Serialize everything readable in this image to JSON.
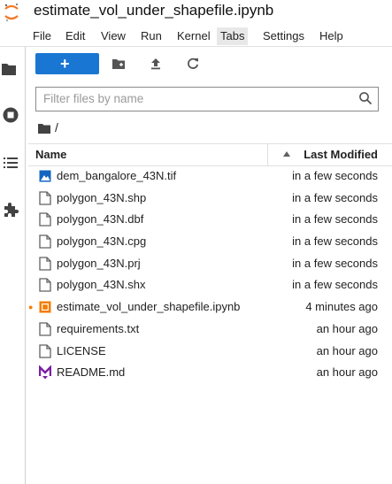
{
  "window": {
    "title": "estimate_vol_under_shapefile.ipynb"
  },
  "menu": [
    {
      "label": "File"
    },
    {
      "label": "Edit"
    },
    {
      "label": "View"
    },
    {
      "label": "Run"
    },
    {
      "label": "Kernel"
    },
    {
      "label": "Tabs"
    },
    {
      "label": "Settings"
    },
    {
      "label": "Help"
    }
  ],
  "sidebar": [
    "folder-icon",
    "running-icon",
    "toc-icon",
    "extension-icon"
  ],
  "toolbar": {
    "new_label": "+",
    "icons": [
      "new-folder-icon",
      "upload-icon",
      "refresh-icon"
    ]
  },
  "filter": {
    "placeholder": "Filter files by name",
    "value": ""
  },
  "breadcrumb": {
    "path": "/"
  },
  "table": {
    "col_name": "Name",
    "col_modified": "Last Modified",
    "rows": [
      {
        "name": "dem_bangalore_43N.tif",
        "modified": "in a few seconds",
        "icon": "image-file-icon"
      },
      {
        "name": "polygon_43N.shp",
        "modified": "in a few seconds",
        "icon": "file-icon"
      },
      {
        "name": "polygon_43N.dbf",
        "modified": "in a few seconds",
        "icon": "file-icon"
      },
      {
        "name": "polygon_43N.cpg",
        "modified": "in a few seconds",
        "icon": "file-icon"
      },
      {
        "name": "polygon_43N.prj",
        "modified": "in a few seconds",
        "icon": "file-icon"
      },
      {
        "name": "polygon_43N.shx",
        "modified": "in a few seconds",
        "icon": "file-icon"
      },
      {
        "name": "estimate_vol_under_shapefile.ipynb",
        "modified": "4 minutes ago",
        "icon": "notebook-icon",
        "running": true
      },
      {
        "name": "requirements.txt",
        "modified": "an hour ago",
        "icon": "file-icon"
      },
      {
        "name": "LICENSE",
        "modified": "an hour ago",
        "icon": "file-icon"
      },
      {
        "name": "README.md",
        "modified": "an hour ago",
        "icon": "markdown-icon"
      }
    ]
  },
  "colors": {
    "accent": "#1976d2",
    "notebook": "#f57c00",
    "markdown": "#7b1fa2"
  }
}
